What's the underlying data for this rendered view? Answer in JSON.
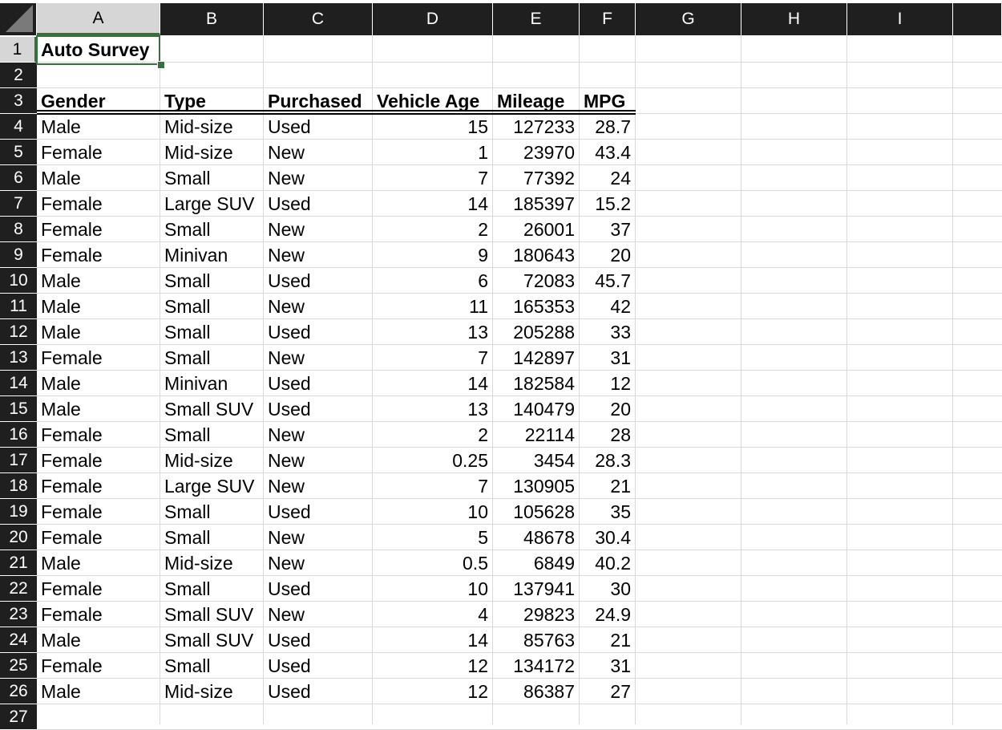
{
  "columns": [
    "A",
    "B",
    "C",
    "D",
    "E",
    "F",
    "G",
    "H",
    "I"
  ],
  "rows": [
    "1",
    "2",
    "3",
    "4",
    "5",
    "6",
    "7",
    "8",
    "9",
    "10",
    "11",
    "12",
    "13",
    "14",
    "15",
    "16",
    "17",
    "18",
    "19",
    "20",
    "21",
    "22",
    "23",
    "24",
    "25",
    "26",
    "27"
  ],
  "selected_cell": "A1",
  "title": "Auto Survey",
  "headers": [
    "Gender",
    "Type",
    "Purchased",
    "Vehicle Age",
    "Mileage",
    "MPG"
  ],
  "data_rows": [
    [
      "Male",
      "Mid-size",
      "Used",
      "15",
      "127233",
      "28.7"
    ],
    [
      "Female",
      "Mid-size",
      "New",
      "1",
      "23970",
      "43.4"
    ],
    [
      "Male",
      "Small",
      "New",
      "7",
      "77392",
      "24"
    ],
    [
      "Female",
      "Large SUV",
      "Used",
      "14",
      "185397",
      "15.2"
    ],
    [
      "Female",
      "Small",
      "New",
      "2",
      "26001",
      "37"
    ],
    [
      "Female",
      "Minivan",
      "New",
      "9",
      "180643",
      "20"
    ],
    [
      "Male",
      "Small",
      "Used",
      "6",
      "72083",
      "45.7"
    ],
    [
      "Male",
      "Small",
      "New",
      "11",
      "165353",
      "42"
    ],
    [
      "Male",
      "Small",
      "Used",
      "13",
      "205288",
      "33"
    ],
    [
      "Female",
      "Small",
      "New",
      "7",
      "142897",
      "31"
    ],
    [
      "Male",
      "Minivan",
      "Used",
      "14",
      "182584",
      "12"
    ],
    [
      "Male",
      "Small SUV",
      "Used",
      "13",
      "140479",
      "20"
    ],
    [
      "Female",
      "Small",
      "New",
      "2",
      "22114",
      "28"
    ],
    [
      "Female",
      "Mid-size",
      "New",
      "0.25",
      "3454",
      "28.3"
    ],
    [
      "Female",
      "Large SUV",
      "New",
      "7",
      "130905",
      "21"
    ],
    [
      "Female",
      "Small",
      "Used",
      "10",
      "105628",
      "35"
    ],
    [
      "Female",
      "Small",
      "New",
      "5",
      "48678",
      "30.4"
    ],
    [
      "Male",
      "Mid-size",
      "New",
      "0.5",
      "6849",
      "40.2"
    ],
    [
      "Female",
      "Small",
      "Used",
      "10",
      "137941",
      "30"
    ],
    [
      "Female",
      "Small SUV",
      "New",
      "4",
      "29823",
      "24.9"
    ],
    [
      "Male",
      "Small SUV",
      "Used",
      "14",
      "85763",
      "21"
    ],
    [
      "Female",
      "Small",
      "Used",
      "12",
      "134172",
      "31"
    ],
    [
      "Male",
      "Mid-size",
      "Used",
      "12",
      "86387",
      "27"
    ]
  ],
  "colors": {
    "header_bg": "#1f1f1f",
    "selected_header_bg": "#d6d6d6",
    "selection": "#3b6e3f",
    "grid": "#d9d9d9"
  }
}
